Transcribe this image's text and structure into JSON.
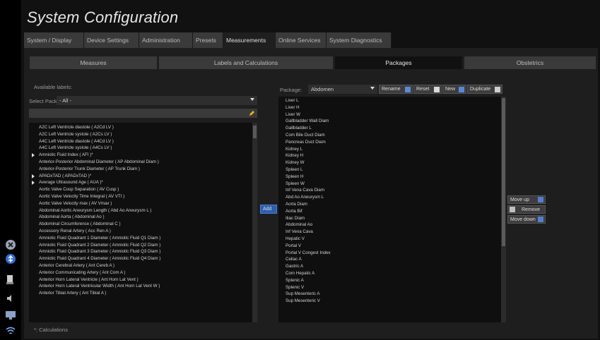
{
  "title": "System Configuration",
  "tabs": [
    "System / Display",
    "Device Settings",
    "Administration",
    "Presets",
    "Measurements",
    "Online Services",
    "System Diagnostics"
  ],
  "active_tab": "Measurements",
  "subtabs": [
    "Measures",
    "Labels and Calculations",
    "Packages",
    "Obstetrics"
  ],
  "active_subtab": "Packages",
  "available_labels_title": "Available labels:",
  "select_package_label": "Select Package",
  "select_package_value": "- All -",
  "available_items": [
    {
      "label": "A2C Left Ventricle diastole ( A2Cd LV )",
      "expandable": false
    },
    {
      "label": "A2C Left Ventricle systole ( A2Cs LV )",
      "expandable": false
    },
    {
      "label": "A4C Left Ventricle diastole ( A4Cd LV )",
      "expandable": false
    },
    {
      "label": "A4C Left Ventricle systole ( A4Cs LV )",
      "expandable": false
    },
    {
      "label": "Amniotic Fluid Index ( AFI )*",
      "expandable": true
    },
    {
      "label": "Anterior-Posterior Abdominal Diameter ( AP Abdominal Diam )",
      "expandable": false
    },
    {
      "label": "Anterior-Posterior Trunk Diameter ( AP Trunk Diam )",
      "expandable": false
    },
    {
      "label": "APADxTAD ( APADxTAD )*",
      "expandable": true
    },
    {
      "label": "Average Ultrasound Age ( AUA )*",
      "expandable": true
    },
    {
      "label": "Aortic Valve Cusp Separation ( AV Cusp )",
      "expandable": false
    },
    {
      "label": "Aortic Valve Velocity Time Integral ( AV VTI )",
      "expandable": false
    },
    {
      "label": "Aortic Valve Velocity max ( AV Vmax )",
      "expandable": false
    },
    {
      "label": "Abdominal Aortic Aneurysm Length ( Abd Ao Aneurysm L )",
      "expandable": false
    },
    {
      "label": "Abdominal Aorta ( Abdominal Ao )",
      "expandable": false
    },
    {
      "label": "Abdominal Circumference ( Abdominal C )",
      "expandable": false
    },
    {
      "label": "Accessory Renal Artery ( Acc Ren A )",
      "expandable": false
    },
    {
      "label": "Amniotic Fluid Quadrant 1 Diameter ( Amniotic Fluid Q1 Diam )",
      "expandable": false
    },
    {
      "label": "Amniotic Fluid Quadrant 2 Diameter ( Amniotic Fluid Q2 Diam )",
      "expandable": false
    },
    {
      "label": "Amniotic Fluid Quadrant 3 Diameter ( Amniotic Fluid Q3 Diam )",
      "expandable": false
    },
    {
      "label": "Amniotic Fluid Quadrant 4 Diameter ( Amniotic Fluid Q4 Diam )",
      "expandable": false
    },
    {
      "label": "Anterior Cerebral Artery ( Ant Cereb A )",
      "expandable": false
    },
    {
      "label": "Anterior Communicating Artery ( Ant Com A )",
      "expandable": false
    },
    {
      "label": "Anterior Horn Lateral Ventricle ( Ant Horn Lat Vent )",
      "expandable": false
    },
    {
      "label": "Anterior Horn Lateral Ventricular Width ( Ant Horn Lat Vent W )",
      "expandable": false
    },
    {
      "label": "Anterior Tibial Artery ( Ant Tibial A )",
      "expandable": false
    }
  ],
  "calculations_note": "*: Calculations",
  "add_button": "Add",
  "package_label": "Package:",
  "package_value": "Abdomen",
  "rename_button": "Rename",
  "reset_button": "Reset",
  "new_button": "New",
  "duplicate_button": "Duplicate",
  "package_items": [
    "Liver L",
    "Liver H",
    "Liver W",
    "Gallbladder Wall Diam",
    "Gallbladder L",
    "Com Bile Duct Diam",
    "Pancreas Duct Diam",
    "Kidney L",
    "Kidney H",
    "Kidney W",
    "Spleen L",
    "Spleen H",
    "Spleen W",
    "Inf Vena Cava Diam",
    "Abd Ao Aneurysm L",
    "Aorta Diam",
    "Aorta Bif",
    "Iliac Diam",
    "Abdominal Ao",
    "Inf Vena Cava",
    "Hepatic V",
    "Portal V",
    "Portal V Congest Index",
    "Celiac A",
    "Gastric A",
    "Com Hepatic A",
    "Splenic A",
    "Splenic V",
    "Sup Mesenteric A",
    "Sup Mesenteric V"
  ],
  "move_up_button": "Move up",
  "remove_button": "Remove",
  "move_down_button": "Move down"
}
